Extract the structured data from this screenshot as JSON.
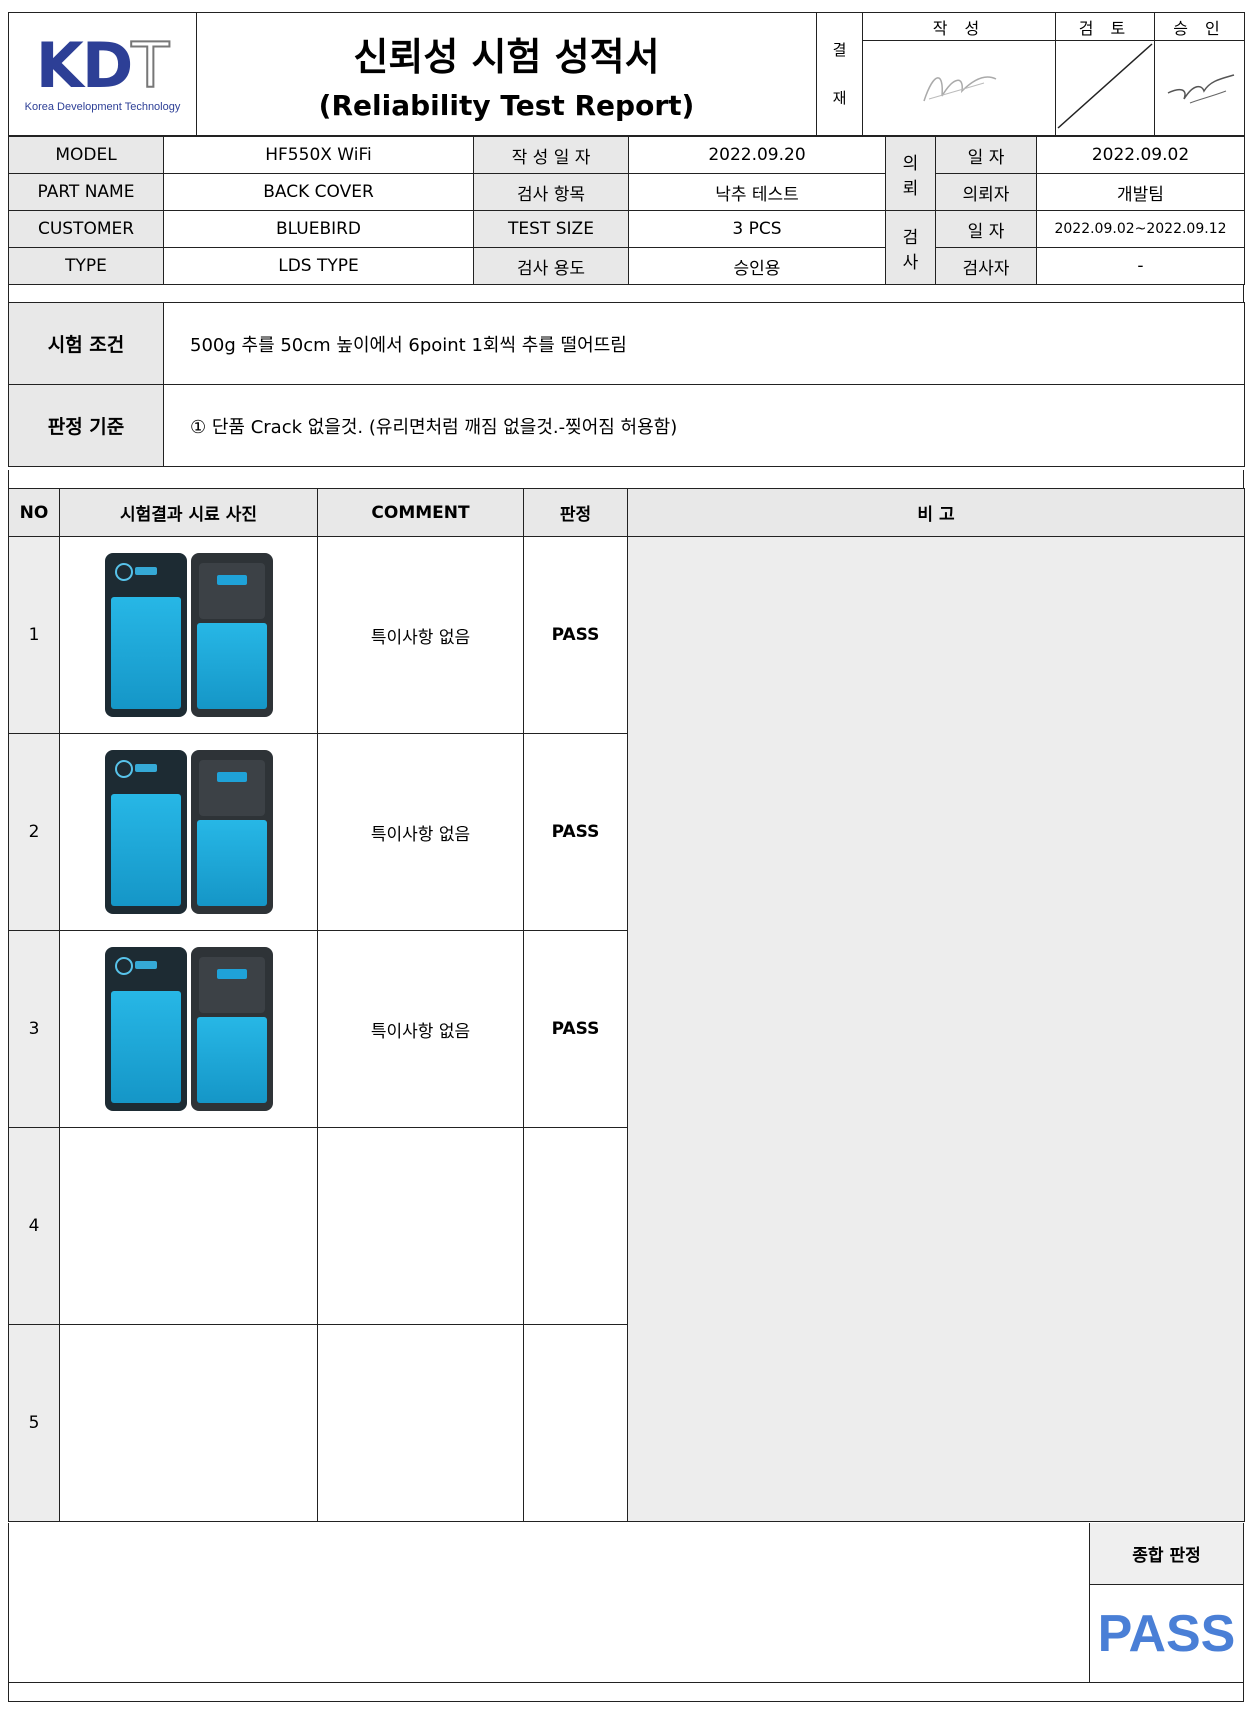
{
  "header": {
    "logo_letters": "KDT",
    "logo_k": "K",
    "logo_d": "D",
    "logo_t": "T",
    "logo_subtitle": "Korea Development Technology",
    "title_ko": "신뢰성 시험 성적서",
    "title_en": "(Reliability Test Report)",
    "approval_label_1": "결",
    "approval_label_2": "재",
    "sign_heads": [
      "작 성",
      "검 토",
      "승 인"
    ],
    "signatures": [
      "signature-author",
      "signature-reviewer-slash",
      "signature-approver"
    ]
  },
  "info": {
    "rows": [
      {
        "k1": "MODEL",
        "v1": "HF550X WiFi",
        "k2": "작 성 일 자",
        "v2": "2022.09.20",
        "k3": "일 자",
        "v3": "2022.09.02"
      },
      {
        "k1": "PART NAME",
        "v1": "BACK COVER",
        "k2": "검사 항목",
        "v2": "낙추 테스트",
        "k3": "의뢰자",
        "v3": "개발팀"
      },
      {
        "k1": "CUSTOMER",
        "v1": "BLUEBIRD",
        "k2": "TEST SIZE",
        "v2": "3 PCS",
        "k3": "일 자",
        "v3": "2022.09.02~2022.09.12"
      },
      {
        "k1": "TYPE",
        "v1": "LDS TYPE",
        "k2": "검사 용도",
        "v2": "승인용",
        "k3": "검사자",
        "v3": "-"
      }
    ],
    "group_request_1": "의",
    "group_request_2": "뢰",
    "group_inspect_1": "검",
    "group_inspect_2": "사"
  },
  "conditions": {
    "test_condition_label": "시험 조건",
    "test_condition_value": "500g 추를 50cm 높이에서 6point 1회씩 추를 떨어뜨림",
    "criteria_label": "판정 기준",
    "criteria_value": "① 단품 Crack 없을것. (유리면처럼 깨짐 없을것.-찢어짐 허용함)"
  },
  "results": {
    "headers": [
      "NO",
      "시험결과 시료 사진",
      "COMMENT",
      "판정",
      "비 고"
    ],
    "rows": [
      {
        "no": "1",
        "comment": "특이사항 없음",
        "verdict": "PASS"
      },
      {
        "no": "2",
        "comment": "특이사항 없음",
        "verdict": "PASS"
      },
      {
        "no": "3",
        "comment": "특이사항 없음",
        "verdict": "PASS"
      },
      {
        "no": "4",
        "comment": "",
        "verdict": ""
      },
      {
        "no": "5",
        "comment": "",
        "verdict": ""
      }
    ]
  },
  "summary": {
    "label": "종합 판정",
    "value": "PASS",
    "value_color": "#4a7fd6"
  },
  "colors": {
    "logo_blue": "#2d3f96",
    "header_gray": "#e8e8e8",
    "screen_blue": "#27b7e6"
  }
}
